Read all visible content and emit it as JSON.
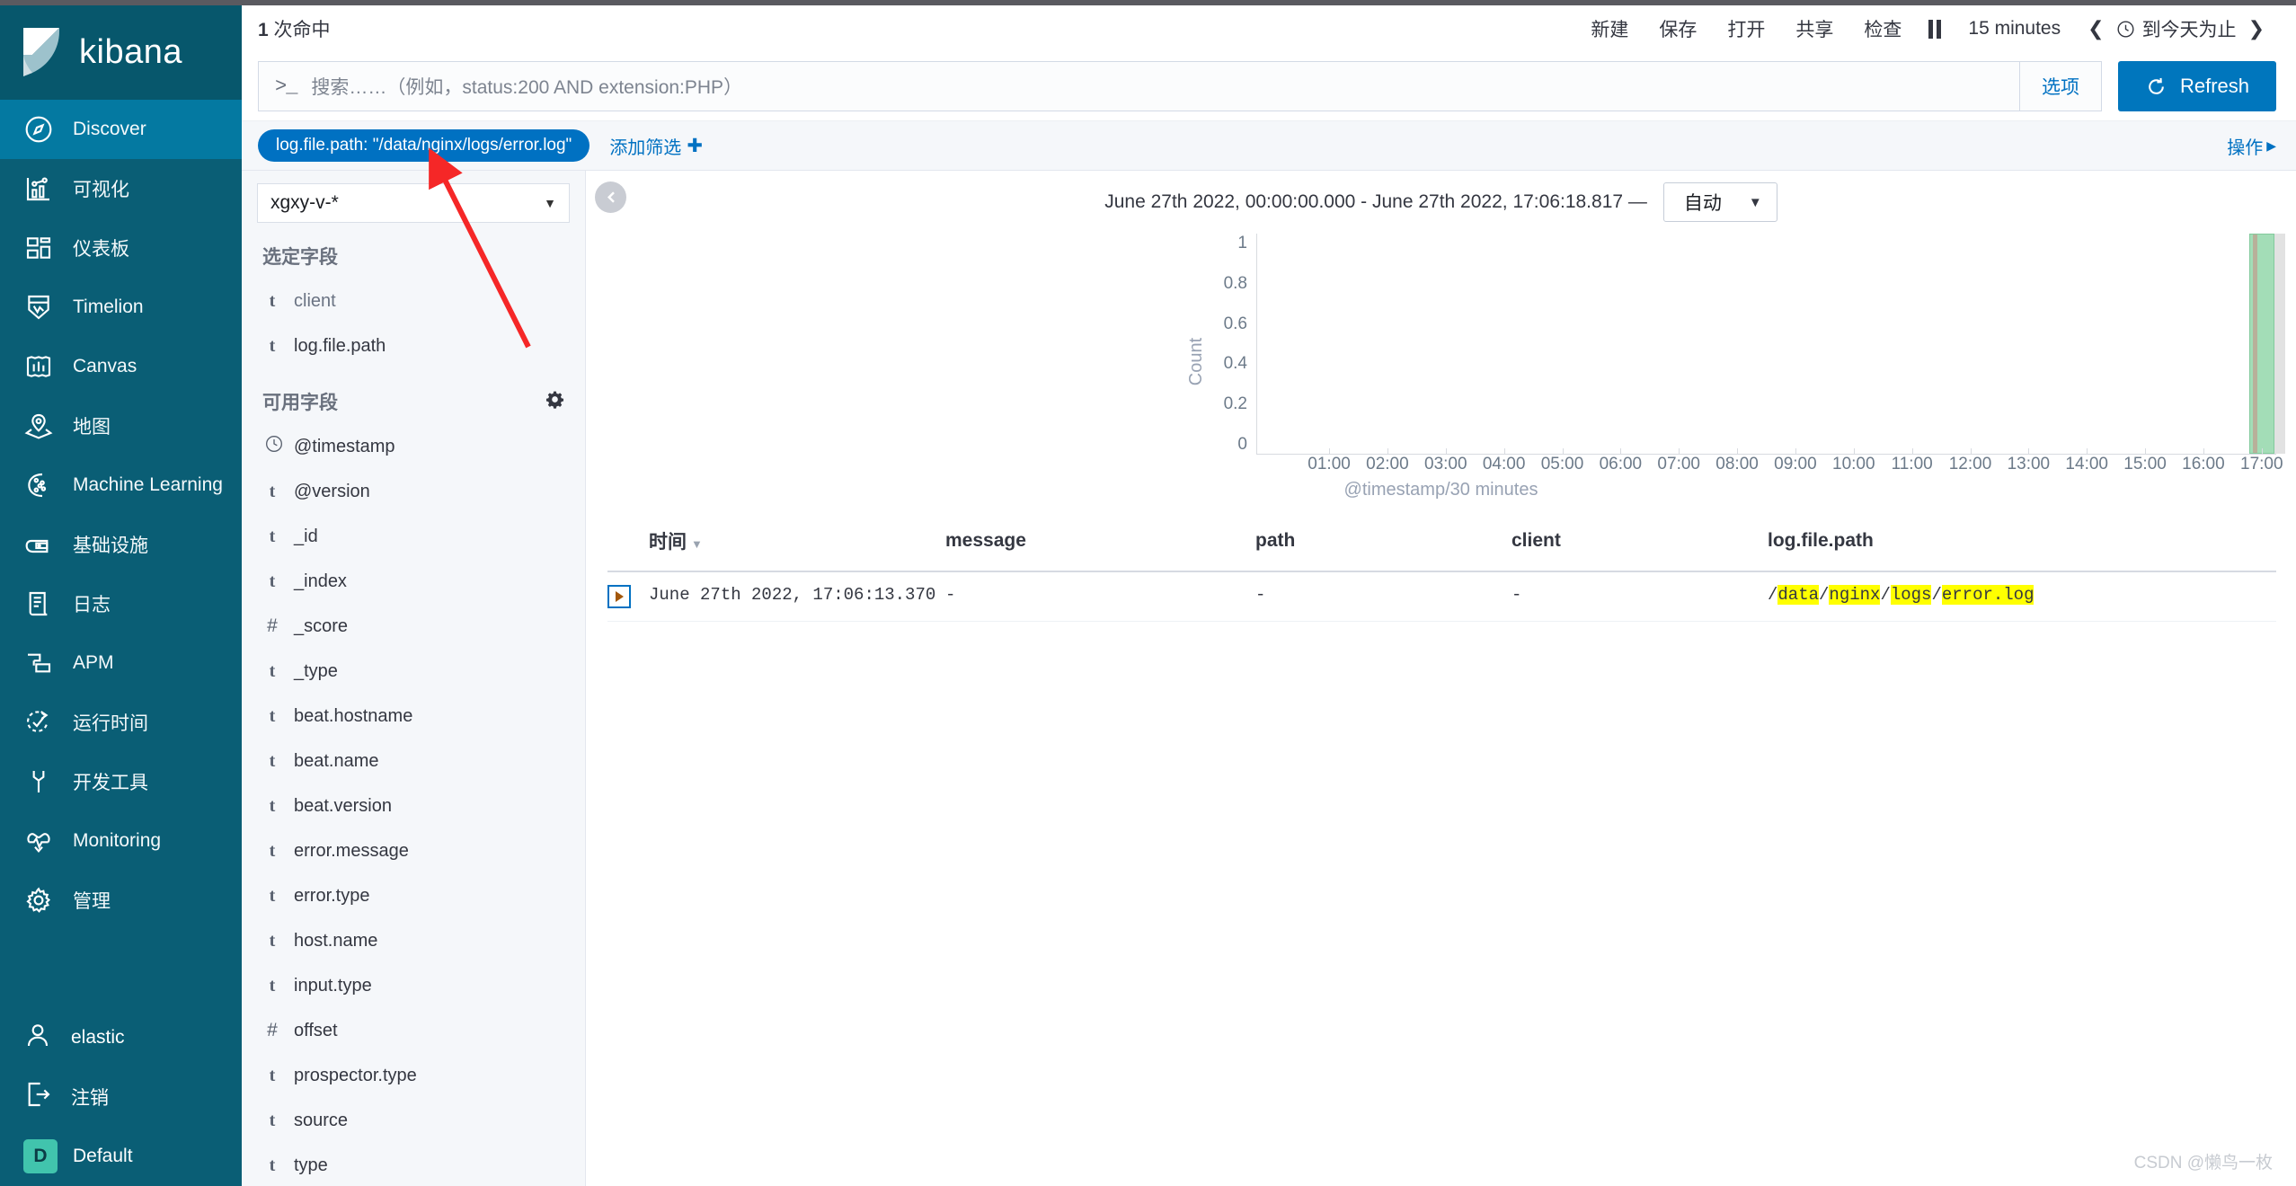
{
  "app": {
    "brand": "kibana",
    "space_badge": "D",
    "space_label": "Default",
    "user_label": "elastic",
    "logout_label": "注销"
  },
  "sidebar": {
    "items": [
      {
        "label": "Discover",
        "icon": "compass-icon",
        "active": true
      },
      {
        "label": "可视化",
        "icon": "visualize-icon",
        "active": false
      },
      {
        "label": "仪表板",
        "icon": "dashboard-icon",
        "active": false
      },
      {
        "label": "Timelion",
        "icon": "timelion-icon",
        "active": false
      },
      {
        "label": "Canvas",
        "icon": "canvas-icon",
        "active": false
      },
      {
        "label": "地图",
        "icon": "maps-icon",
        "active": false
      },
      {
        "label": "Machine Learning",
        "icon": "machine-learning-icon",
        "active": false
      },
      {
        "label": "基础设施",
        "icon": "infrastructure-icon",
        "active": false
      },
      {
        "label": "日志",
        "icon": "logs-icon",
        "active": false
      },
      {
        "label": "APM",
        "icon": "apm-icon",
        "active": false
      },
      {
        "label": "运行时间",
        "icon": "uptime-icon",
        "active": false
      },
      {
        "label": "开发工具",
        "icon": "wrench-icon",
        "active": false
      },
      {
        "label": "Monitoring",
        "icon": "monitoring-icon",
        "active": false
      },
      {
        "label": "管理",
        "icon": "gear-icon",
        "active": false
      }
    ]
  },
  "topbar": {
    "hits_count": "1",
    "hits_suffix": "次命中",
    "new_label": "新建",
    "save_label": "保存",
    "open_label": "打开",
    "share_label": "共享",
    "inspect_label": "检查",
    "refresh_interval": "15 minutes",
    "time_quick_label": "到今天为止"
  },
  "query": {
    "placeholder": "搜索……（例如，status:200 AND extension:PHP）",
    "value": "",
    "prompt_glyph": ">_",
    "options_label": "选项",
    "refresh_label": "Refresh"
  },
  "filters": {
    "pill_label": "log.file.path: \"/data/nginx/logs/error.log\"",
    "add_filter_label": "添加筛选",
    "actions_label": "操作"
  },
  "fields_panel": {
    "index_pattern": "xgxy-v-*",
    "selected_title": "选定字段",
    "available_title": "可用字段",
    "selected": [
      {
        "name": "client",
        "type": "t"
      },
      {
        "name": "log.file.path",
        "type": "t"
      }
    ],
    "available": [
      {
        "name": "@timestamp",
        "type": "clock"
      },
      {
        "name": "@version",
        "type": "t"
      },
      {
        "name": "_id",
        "type": "t"
      },
      {
        "name": "_index",
        "type": "t"
      },
      {
        "name": "_score",
        "type": "#"
      },
      {
        "name": "_type",
        "type": "t"
      },
      {
        "name": "beat.hostname",
        "type": "t"
      },
      {
        "name": "beat.name",
        "type": "t"
      },
      {
        "name": "beat.version",
        "type": "t"
      },
      {
        "name": "error.message",
        "type": "t"
      },
      {
        "name": "error.type",
        "type": "t"
      },
      {
        "name": "host.name",
        "type": "t"
      },
      {
        "name": "input.type",
        "type": "t"
      },
      {
        "name": "offset",
        "type": "#"
      },
      {
        "name": "prospector.type",
        "type": "t"
      },
      {
        "name": "source",
        "type": "t"
      },
      {
        "name": "type",
        "type": "t"
      }
    ]
  },
  "chart_header": {
    "time_range": "June 27th 2022, 00:00:00.000 - June 27th 2022, 17:06:18.817 —",
    "interval": "自动"
  },
  "chart_data": {
    "type": "bar",
    "title": "",
    "xlabel": "@timestamp/30 minutes",
    "ylabel": "Count",
    "ylim": [
      0,
      1
    ],
    "ytick_labels": [
      "1",
      "0.8",
      "0.6",
      "0.4",
      "0.2",
      "0"
    ],
    "yticks": [
      1,
      0.8,
      0.6,
      0.4,
      0.2,
      0
    ],
    "xtick_labels": [
      "01:00",
      "02:00",
      "03:00",
      "04:00",
      "05:00",
      "06:00",
      "07:00",
      "08:00",
      "09:00",
      "10:00",
      "11:00",
      "12:00",
      "13:00",
      "14:00",
      "15:00",
      "16:00",
      "17:00"
    ],
    "x": [
      "00:00",
      "00:30",
      "01:00",
      "01:30",
      "02:00",
      "02:30",
      "03:00",
      "03:30",
      "04:00",
      "04:30",
      "05:00",
      "05:30",
      "06:00",
      "06:30",
      "07:00",
      "07:30",
      "08:00",
      "08:30",
      "09:00",
      "09:30",
      "10:00",
      "10:30",
      "11:00",
      "11:30",
      "12:00",
      "12:30",
      "13:00",
      "13:30",
      "14:00",
      "14:30",
      "15:00",
      "15:30",
      "16:00",
      "16:30",
      "17:00"
    ],
    "values": [
      0,
      0,
      0,
      0,
      0,
      0,
      0,
      0,
      0,
      0,
      0,
      0,
      0,
      0,
      0,
      0,
      0,
      0,
      0,
      0,
      0,
      0,
      0,
      0,
      0,
      0,
      0,
      0,
      0,
      0,
      0,
      0,
      0,
      0,
      1
    ],
    "bar_color": "#94d8ab",
    "grid": false,
    "legend": "none"
  },
  "table": {
    "columns": [
      "时间",
      "message",
      "path",
      "client",
      "log.file.path"
    ],
    "rows": [
      {
        "time": "June 27th 2022, 17:06:13.370",
        "message": "-",
        "path": "-",
        "client": "-",
        "log_file_path_segments": [
          {
            "text": "/",
            "highlight": false
          },
          {
            "text": "data",
            "highlight": true
          },
          {
            "text": "/",
            "highlight": false
          },
          {
            "text": "nginx",
            "highlight": true
          },
          {
            "text": "/",
            "highlight": false
          },
          {
            "text": "logs",
            "highlight": true
          },
          {
            "text": "/",
            "highlight": false
          },
          {
            "text": "error.log",
            "highlight": true
          }
        ]
      }
    ]
  },
  "watermark": "CSDN @懒鸟一枚",
  "colors": {
    "sidebar_bg": "#0a5e75",
    "sidebar_active": "#0479a1",
    "accent_blue": "#0071c2",
    "button_blue": "#0076bd",
    "bar_green": "#94d8ab",
    "highlight_yellow": "#ffff00",
    "space_badge": "#41c4ad",
    "annotation_red": "#f52727"
  }
}
